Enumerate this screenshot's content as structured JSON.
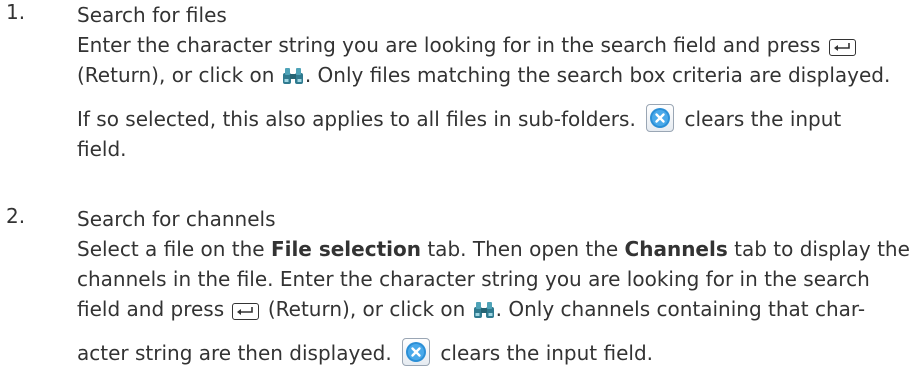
{
  "items": [
    {
      "number": "1.",
      "title": "Search for files",
      "line1_a": "Enter the character string you are looking for in the search field and press",
      "line2_a": "(Return), or click on",
      "line2_b": ". Only files matching the search box criteria are displayed.",
      "line3_a": "If so selected, this also applies to all files in sub-folders.",
      "line3_b": "clears the input",
      "line4_a": "field."
    },
    {
      "number": "2.",
      "title": "Search for channels",
      "line1_a": "Select a file on the",
      "line1_b": "File selection",
      "line1_c": "tab. Then open the",
      "line1_d": "Channels",
      "line1_e": "tab to display the",
      "line2_a": "channels in the file. Enter the character string you are looking for in the search",
      "line3_a": "field and press",
      "line3_b": "(Return), or click on",
      "line3_c": ". Only channels containing that char-",
      "line4_a": "acter string are then displayed.",
      "line4_b": "clears the input field."
    }
  ],
  "icons": {
    "return_key": "return-key-icon",
    "search": "binoculars-icon",
    "clear": "clear-input-icon"
  }
}
